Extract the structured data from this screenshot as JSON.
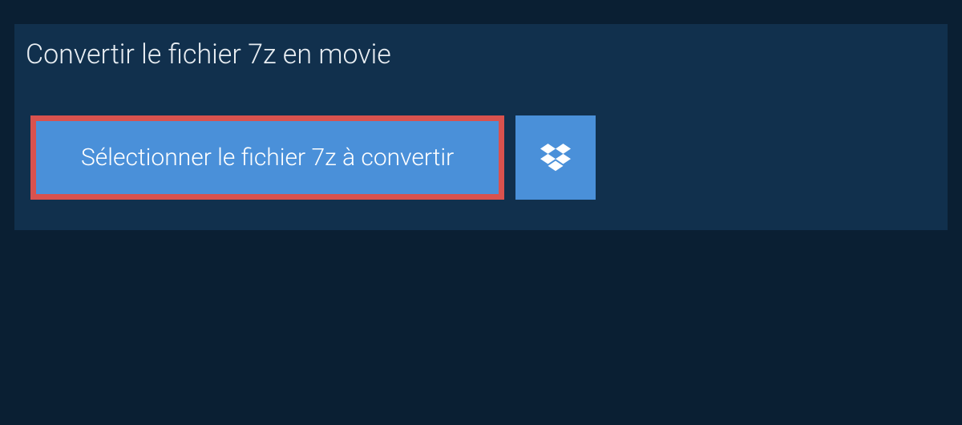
{
  "header": {
    "title": "Convertir le fichier 7z en movie"
  },
  "buttons": {
    "select_file_label": "Sélectionner le fichier 7z à convertir",
    "dropbox_icon": "dropbox-icon"
  }
}
